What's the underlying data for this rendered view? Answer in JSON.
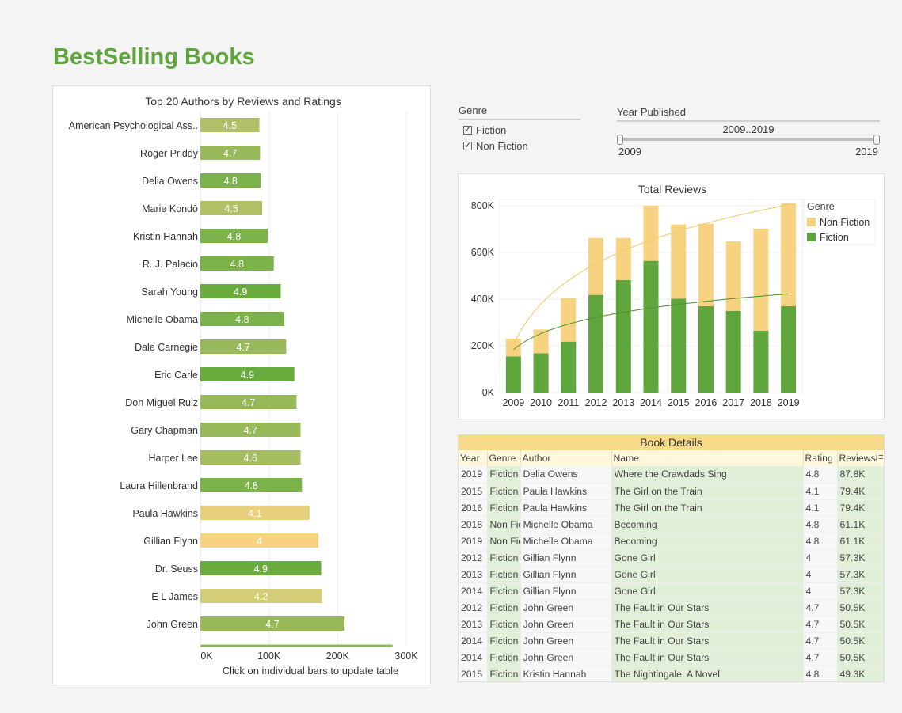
{
  "page": {
    "title": "BestSelling Books"
  },
  "authors_chart": {
    "title": "Top 20 Authors by Reviews and Ratings",
    "footnote": "Click on individual bars to update table",
    "x_ticks": [
      "0K",
      "100K",
      "200K",
      "300K"
    ],
    "colors": {
      "4.9": "#6aab3e",
      "4.8": "#7bb24c",
      "4.7": "#98b95a",
      "4.6": "#a5bd60",
      "4.5": "#b1c067",
      "4.2": "#d4cd78",
      "4.1": "#e8cf7b",
      "4.0": "#f7d381"
    }
  },
  "filters": {
    "genre": {
      "label": "Genre",
      "options": [
        "Fiction",
        "Non Fiction"
      ]
    },
    "year": {
      "label": "Year Published",
      "range_text": "2009..2019",
      "min": "2009",
      "max": "2019"
    }
  },
  "reviews_chart": {
    "title": "Total Reviews",
    "y_ticks": [
      "0K",
      "200K",
      "400K",
      "600K",
      "800K"
    ],
    "legend_title": "Genre",
    "colors": {
      "Non Fiction": "#f7d381",
      "Fiction": "#5ea63c"
    }
  },
  "table": {
    "title": "Book Details",
    "columns": [
      "Year",
      "Genre",
      "Author",
      "Name",
      "Rating",
      "Reviews"
    ],
    "rows": [
      [
        "2019",
        "Fiction",
        "Delia Owens",
        "Where the Crawdads Sing",
        "4.8",
        "87.8K"
      ],
      [
        "2015",
        "Fiction",
        "Paula Hawkins",
        "The Girl on the Train",
        "4.1",
        "79.4K"
      ],
      [
        "2016",
        "Fiction",
        "Paula Hawkins",
        "The Girl on the Train",
        "4.1",
        "79.4K"
      ],
      [
        "2018",
        "Non Fiction",
        "Michelle Obama",
        "Becoming",
        "4.8",
        "61.1K"
      ],
      [
        "2019",
        "Non Fiction",
        "Michelle Obama",
        "Becoming",
        "4.8",
        "61.1K"
      ],
      [
        "2012",
        "Fiction",
        "Gillian Flynn",
        "Gone Girl",
        "4",
        "57.3K"
      ],
      [
        "2013",
        "Fiction",
        "Gillian Flynn",
        "Gone Girl",
        "4",
        "57.3K"
      ],
      [
        "2014",
        "Fiction",
        "Gillian Flynn",
        "Gone Girl",
        "4",
        "57.3K"
      ],
      [
        "2012",
        "Fiction",
        "John Green",
        "The Fault in Our Stars",
        "4.7",
        "50.5K"
      ],
      [
        "2013",
        "Fiction",
        "John Green",
        "The Fault in Our Stars",
        "4.7",
        "50.5K"
      ],
      [
        "2014",
        "Fiction",
        "John Green",
        "The Fault in Our Stars",
        "4.7",
        "50.5K"
      ],
      [
        "2014",
        "Fiction",
        "John Green",
        "The Fault in Our Stars",
        "4.7",
        "50.5K"
      ],
      [
        "2015",
        "Fiction",
        "Kristin Hannah",
        "The Nightingale: A Novel",
        "4.8",
        "49.3K"
      ]
    ]
  },
  "chart_data": [
    {
      "type": "bar",
      "orientation": "horizontal",
      "title": "Top 20 Authors by Reviews and Ratings",
      "xlabel": "",
      "xlim": [
        0,
        300000
      ],
      "categories": [
        "American Psychological Ass..",
        "Roger Priddy",
        "Delia Owens",
        "Marie Kondō",
        "Kristin Hannah",
        "R. J. Palacio",
        "Sarah Young",
        "Michelle Obama",
        "Dale Carnegie",
        "Eric Carle",
        "Don Miguel Ruiz",
        "Gary Chapman",
        "Harper Lee",
        "Laura Hillenbrand",
        "Paula Hawkins",
        "Gillian Flynn",
        "Dr. Seuss",
        "E L James",
        "John Green"
      ],
      "values": [
        86000,
        87000,
        88000,
        90000,
        98000,
        107000,
        117000,
        122000,
        125000,
        137000,
        140000,
        146000,
        146000,
        148000,
        159000,
        172000,
        176000,
        177000,
        210000
      ],
      "labels": [
        "4.5",
        "4.7",
        "4.8",
        "4.5",
        "4.8",
        "4.8",
        "4.9",
        "4.8",
        "4.7",
        "4.9",
        "4.7",
        "4.7",
        "4.6",
        "4.8",
        "4.1",
        "4",
        "4.9",
        "4.2",
        "4.7"
      ],
      "grid": true
    },
    {
      "type": "bar",
      "stacked": true,
      "title": "Total Reviews",
      "categories": [
        "2009",
        "2010",
        "2011",
        "2012",
        "2013",
        "2014",
        "2015",
        "2016",
        "2017",
        "2018",
        "2019"
      ],
      "ylim": [
        0,
        800000
      ],
      "series": [
        {
          "name": "Fiction",
          "values": [
            155000,
            168000,
            218000,
            418000,
            482000,
            564000,
            402000,
            370000,
            350000,
            265000,
            370000
          ]
        },
        {
          "name": "Non Fiction",
          "values": [
            75000,
            102000,
            187000,
            244000,
            180000,
            237000,
            318000,
            353000,
            297000,
            437000,
            441000
          ]
        }
      ],
      "trendlines": [
        "Non Fiction",
        "Fiction"
      ],
      "legend": "top-right",
      "grid": true
    }
  ]
}
